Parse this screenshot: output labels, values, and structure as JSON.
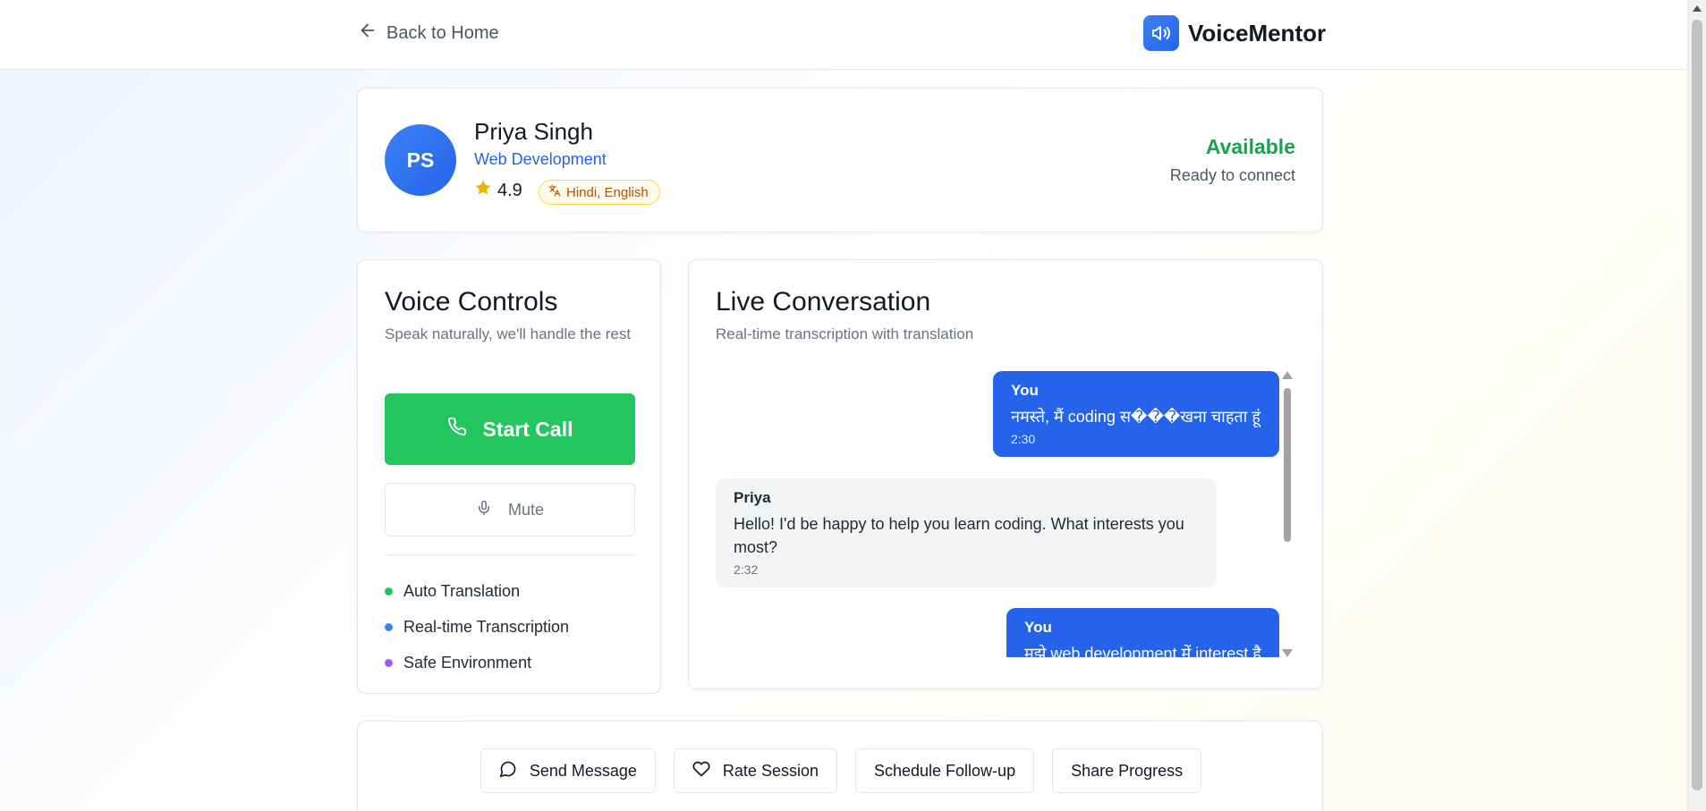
{
  "header": {
    "back_label": "Back to Home",
    "brand_name": "VoiceMentor"
  },
  "mentor": {
    "initials": "PS",
    "name": "Priya Singh",
    "field": "Web Development",
    "rating": "4.9",
    "languages": "Hindi, English",
    "status": "Available",
    "status_sub": "Ready to connect"
  },
  "controls": {
    "title": "Voice Controls",
    "subtitle": "Speak naturally, we'll handle the rest",
    "start_call_label": "Start Call",
    "mute_label": "Mute",
    "features": [
      {
        "label": "Auto Translation",
        "color": "#22c55e"
      },
      {
        "label": "Real-time Transcription",
        "color": "#3b82f6"
      },
      {
        "label": "Safe Environment",
        "color": "#a855f7"
      }
    ]
  },
  "conversation": {
    "title": "Live Conversation",
    "subtitle": "Real-time transcription with translation",
    "messages": [
      {
        "sender": "You",
        "text": "नमस्ते, मैं coding स���खना चाहता हूं",
        "time": "2:30"
      },
      {
        "sender": "Priya",
        "text": "Hello! I'd be happy to help you learn coding. What interests you most?",
        "time": "2:32"
      },
      {
        "sender": "You",
        "text": "मुझे web development में interest है",
        "time": ""
      }
    ]
  },
  "actions": {
    "send_message": "Send Message",
    "rate_session": "Rate Session",
    "schedule_followup": "Schedule Follow-up",
    "share_progress": "Share Progress"
  },
  "colors": {
    "primary": "#2563eb",
    "success": "#22c55e",
    "status_green": "#16a34a",
    "badge_amber": "#b45309"
  }
}
